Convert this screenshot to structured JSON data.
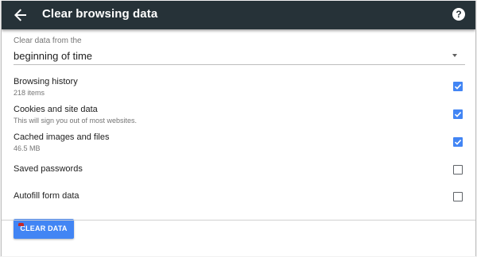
{
  "header": {
    "title": "Clear browsing data",
    "back_icon": "arrow-left-icon",
    "help_icon": "help-circle-icon",
    "help_glyph": "?",
    "background_color": "#263238"
  },
  "time_range": {
    "label": "Clear data from the",
    "selected": "beginning of time"
  },
  "options": [
    {
      "label": "Browsing history",
      "sublabel": "218 items",
      "checked": true
    },
    {
      "label": "Cookies and site data",
      "sublabel": "This will sign you out of most websites.",
      "checked": true
    },
    {
      "label": "Cached images and files",
      "sublabel": "46.5 MB",
      "checked": true
    },
    {
      "label": "Saved passwords",
      "sublabel": "",
      "checked": false
    },
    {
      "label": "Autofill form data",
      "sublabel": "",
      "checked": false
    }
  ],
  "clear_button": {
    "label": "CLEAR DATA",
    "color": "#4285f4"
  },
  "accent_color": "#4285f4"
}
